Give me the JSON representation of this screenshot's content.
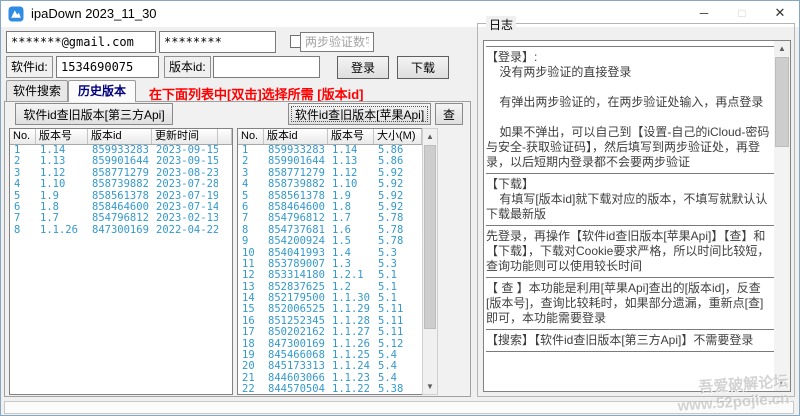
{
  "window": {
    "title": "ipaDown 2023_11_30"
  },
  "titlebar": {
    "minimize": "─",
    "maximize": "□",
    "close": "✕"
  },
  "colors": {
    "data_blue": "#3399cc",
    "hint_red": "#ff0000",
    "tab_active_navy": "#000080",
    "icon_blue": "#2f8ce4",
    "watermark_gray": "#afafaf"
  },
  "login": {
    "email_value": "*******@gmail.com",
    "password_value": "********",
    "twofa_placeholder": "两步验证数字"
  },
  "query": {
    "app_id_label": "软件id:",
    "app_id_value": "1534690075",
    "version_id_label": "版本id:",
    "version_id_value": "",
    "login_button": "登录",
    "download_button": "下载"
  },
  "tabs": {
    "search": "软件搜索",
    "history": "历史版本"
  },
  "hint": "在下面列表中[双击]选择所需 [版本id]",
  "toolbar": {
    "third_party_button": "软件id查旧版本[第三方Api]",
    "apple_button": "软件id查旧版本[苹果Api]",
    "check_button": "查"
  },
  "left_table": {
    "headers": [
      "No.",
      "版本号",
      "版本id",
      "更新时间",
      ""
    ],
    "rows": [
      [
        "1",
        "1.14",
        "859933283",
        "2023-09-15",
        ""
      ],
      [
        "2",
        "1.13",
        "859901644",
        "2023-09-15",
        ""
      ],
      [
        "3",
        "1.12",
        "858771279",
        "2023-08-23",
        ""
      ],
      [
        "4",
        "1.10",
        "858739882",
        "2023-07-28",
        ""
      ],
      [
        "5",
        "1.9",
        "858561378",
        "2023-07-19",
        ""
      ],
      [
        "6",
        "1.8",
        "858464600",
        "2023-07-14",
        ""
      ],
      [
        "7",
        "1.7",
        "854796812",
        "2023-02-13",
        ""
      ],
      [
        "8",
        "1.1.26",
        "847300169",
        "2022-04-22",
        ""
      ]
    ]
  },
  "right_table": {
    "headers": [
      "No.",
      "版本id",
      "版本号",
      "大小(M)"
    ],
    "rows": [
      [
        "1",
        "859933283",
        "1.14",
        "5.86"
      ],
      [
        "2",
        "859901644",
        "1.13",
        "5.86"
      ],
      [
        "3",
        "858771279",
        "1.12",
        "5.92"
      ],
      [
        "4",
        "858739882",
        "1.10",
        "5.92"
      ],
      [
        "5",
        "858561378",
        "1.9",
        "5.92"
      ],
      [
        "6",
        "858464600",
        "1.8",
        "5.92"
      ],
      [
        "7",
        "854796812",
        "1.7",
        "5.78"
      ],
      [
        "8",
        "854737681",
        "1.6",
        "5.78"
      ],
      [
        "9",
        "854200924",
        "1.5",
        "5.78"
      ],
      [
        "10",
        "854041993",
        "1.4",
        "5.3"
      ],
      [
        "11",
        "853789007",
        "1.3",
        "5.3"
      ],
      [
        "12",
        "853314180",
        "1.2.1",
        "5.1"
      ],
      [
        "13",
        "852837625",
        "1.2",
        "5.1"
      ],
      [
        "14",
        "852179500",
        "1.1.30",
        "5.1"
      ],
      [
        "15",
        "852006525",
        "1.1.29",
        "5.11"
      ],
      [
        "16",
        "851252345",
        "1.1.28",
        "5.11"
      ],
      [
        "17",
        "850202162",
        "1.1.27",
        "5.11"
      ],
      [
        "18",
        "847300169",
        "1.1.26",
        "5.12"
      ],
      [
        "19",
        "845466068",
        "1.1.25",
        "5.4"
      ],
      [
        "20",
        "845173313",
        "1.1.24",
        "5.4"
      ],
      [
        "21",
        "844603066",
        "1.1.23",
        "5.4"
      ],
      [
        "22",
        "844570504",
        "1.1.22",
        "5.38"
      ]
    ]
  },
  "log": {
    "title": "日志",
    "sections": [
      [
        "【登录】:",
        "    没有两步验证的直接登录",
        "",
        "    有弹出两步验证的，在两步验证处输入，再点登录",
        "",
        "    如果不弹出，可以自己到【设置-自己的iCloud-密码与安全-获取验证码】，然后填写到两步验证处，再登录，以后短期内登录都不会要两步验证"
      ],
      [
        "【下载】",
        "    有填写[版本id]就下载对应的版本，不填写就默认认下载最新版"
      ],
      [
        "先登录，再操作【软件id查旧版本[苹果Api]】【查】和【下载】，下载对Cookie要求严格，所以时间比较短，查询功能则可以使用较长时间"
      ],
      [
        "【 查 】本功能是利用[苹果Api]查出的[版本id]，反查[版本号]，查询比较耗时，如果部分遗漏，重新点[查]即可，本功能需要登录"
      ],
      [
        "【搜索】【软件id查旧版本[第三方Api]】不需要登录"
      ]
    ]
  },
  "watermark": {
    "line1": "吾爱破解论坛",
    "line2": "www.52pojie.cn"
  }
}
